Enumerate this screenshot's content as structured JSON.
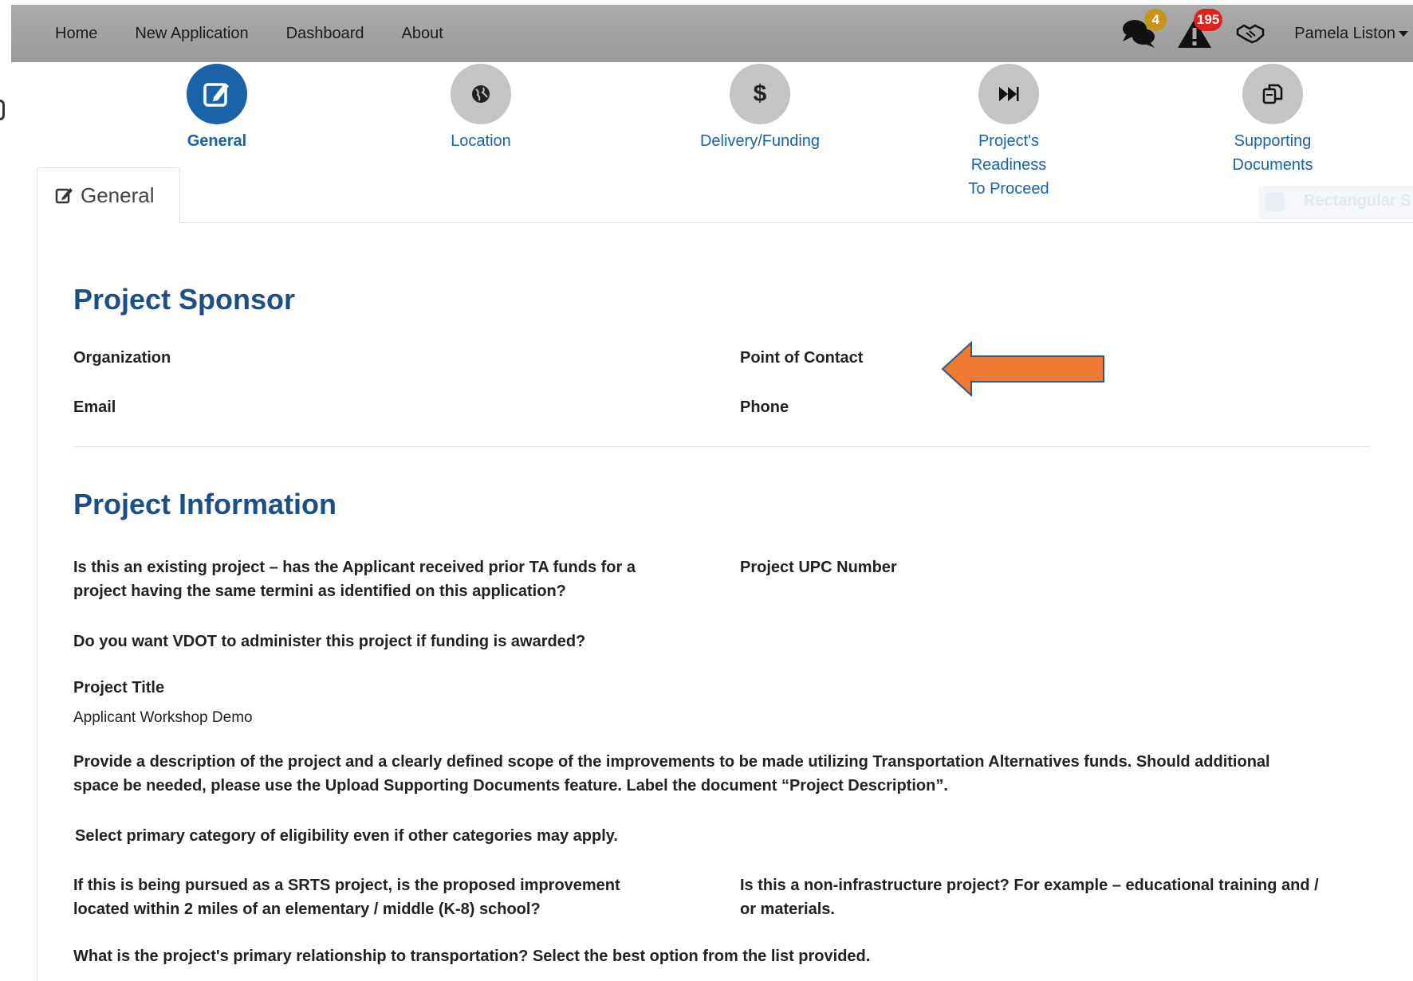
{
  "nav": {
    "links": [
      "Home",
      "New Application",
      "Dashboard",
      "About"
    ],
    "messages_badge": "4",
    "alerts_badge": "195",
    "user_name": "Pamela Liston"
  },
  "steps": [
    {
      "label": "General",
      "icon": "edit-icon",
      "active": true
    },
    {
      "label": "Location",
      "icon": "globe-icon",
      "active": false
    },
    {
      "label": "Delivery/Funding",
      "icon": "dollar-icon",
      "active": false
    },
    {
      "label_lines": [
        "Project's",
        "Readiness",
        "To Proceed"
      ],
      "icon": "fast-forward-icon",
      "active": false
    },
    {
      "label_lines": [
        "Supporting",
        "Documents"
      ],
      "icon": "copy-icon",
      "active": false
    }
  ],
  "ghost_text": "Rectangular S",
  "tab": {
    "label": "General"
  },
  "sponsor": {
    "title": "Project Sponsor",
    "organization": "Organization",
    "point_of_contact": "Point of Contact",
    "email": "Email",
    "phone": "Phone"
  },
  "info": {
    "title": "Project Information",
    "existing_q_lines": [
      "Is this an existing project – has the Applicant received prior TA funds for a",
      "project having the same termini as identified on this application?"
    ],
    "upc": "Project UPC Number",
    "vdot_q": "Do you want VDOT to administer this project if funding is awarded?",
    "title_label": "Project Title",
    "title_value": "Applicant Workshop Demo",
    "description_lines": [
      "Provide a description of the project and a clearly defined scope of the improvements to be made utilizing Transportation Alternatives funds. Should additional",
      "space be needed, please use the Upload Supporting Documents feature. Label the document “Project Description”."
    ],
    "category_q": "Select primary category of eligibility even if other categories may apply.",
    "srts_q_lines": [
      "If this is being pursued as a SRTS project, is the proposed improvement",
      "located within 2 miles of an elementary / middle (K-8) school?"
    ],
    "non_infra_q_lines": [
      "Is this a non-infrastructure project? For example – educational training and /",
      "or materials."
    ],
    "relationship_q": "What is the project's primary relationship to transportation? Select the best option from the list provided."
  },
  "colors": {
    "accent": "#1b63a8",
    "heading": "#1b4f86",
    "arrow": "#f07a33",
    "badge_gold": "#c8951a",
    "badge_red": "#e0211c"
  }
}
